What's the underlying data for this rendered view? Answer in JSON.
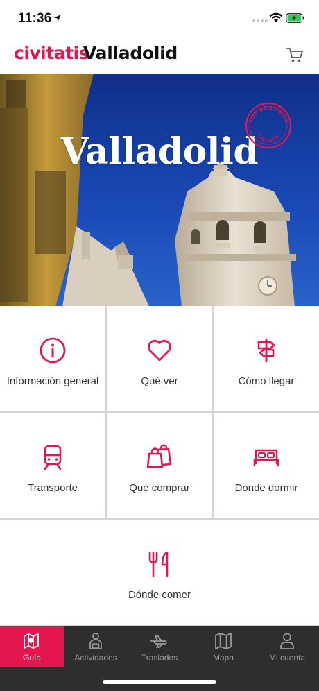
{
  "status_bar": {
    "time": "11:36",
    "icons": [
      "location-arrow-icon",
      "signal-dots-icon",
      "wifi-icon",
      "battery-charging-icon"
    ]
  },
  "header": {
    "brand": "civitatis",
    "city": "Valladolid",
    "cart_icon": "shopping-cart-icon"
  },
  "hero": {
    "title": "Valladolid",
    "stamp_top": "TOP DESTINOS",
    "stamp_bottom": "CIVITATIS"
  },
  "grid": {
    "items": [
      {
        "label": "Información general",
        "icon": "info-circle-icon"
      },
      {
        "label": "Qué ver",
        "icon": "heart-icon"
      },
      {
        "label": "Cómo llegar",
        "icon": "signpost-icon"
      },
      {
        "label": "Transporte",
        "icon": "train-icon"
      },
      {
        "label": "Qué comprar",
        "icon": "shopping-bags-icon"
      },
      {
        "label": "Dónde dormir",
        "icon": "bed-icon"
      },
      {
        "label": "Dónde comer",
        "icon": "fork-knife-icon"
      }
    ]
  },
  "tabbar": {
    "tabs": [
      {
        "label": "Guía",
        "icon": "map-icon",
        "active": true
      },
      {
        "label": "Actividades",
        "icon": "activities-icon",
        "active": false
      },
      {
        "label": "Traslados",
        "icon": "plane-icon",
        "active": false
      },
      {
        "label": "Mapa",
        "icon": "folded-map-icon",
        "active": false
      },
      {
        "label": "Mi cuenta",
        "icon": "user-icon",
        "active": false
      }
    ]
  },
  "colors": {
    "brand": "#e4164e",
    "tabbar_bg": "#2e2e2e",
    "sky": "#123a9c"
  }
}
